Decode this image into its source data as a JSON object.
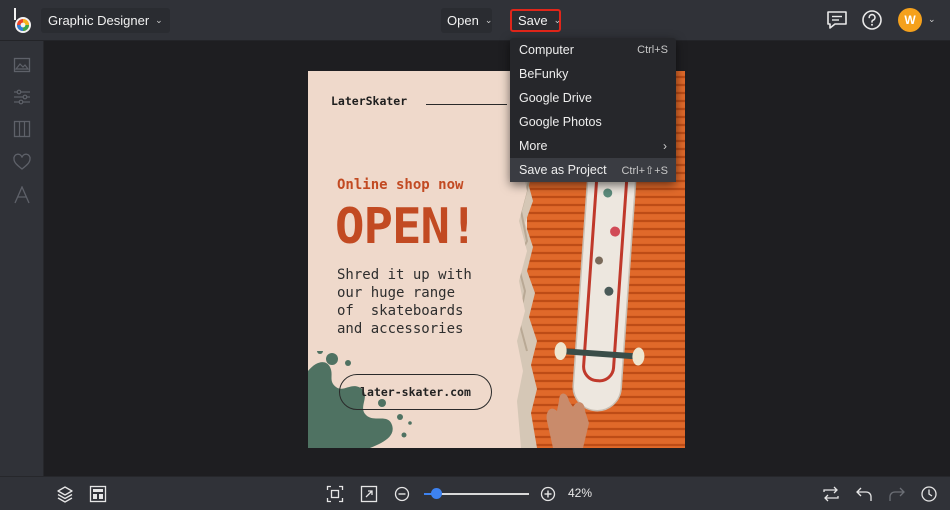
{
  "header": {
    "app_mode": "Graphic Designer",
    "open_label": "Open",
    "save_label": "Save",
    "avatar_initial": "W"
  },
  "save_menu": {
    "items": [
      {
        "label": "Computer",
        "shortcut": "Ctrl+S"
      },
      {
        "label": "BeFunky",
        "shortcut": ""
      },
      {
        "label": "Google Drive",
        "shortcut": ""
      },
      {
        "label": "Google Photos",
        "shortcut": ""
      },
      {
        "label": "More",
        "shortcut": ""
      },
      {
        "label": "Save as Project",
        "shortcut": "Ctrl+⇧+S"
      }
    ]
  },
  "design": {
    "brand": "LaterSkater",
    "tagline": "Online shop now",
    "headline": "OPEN!",
    "body_lines": [
      "Shred it up with",
      "our huge range",
      "of  skateboards",
      "and accessories"
    ],
    "url": "later-skater.com"
  },
  "zoom": {
    "percent_label": "42%",
    "level": 0.07
  },
  "colors": {
    "accent": "#3d82f0",
    "highlight_border": "#e0261a",
    "design_text": "#c24a22",
    "avatar": "#f5a11c",
    "wall_orange": "#e0692a"
  }
}
